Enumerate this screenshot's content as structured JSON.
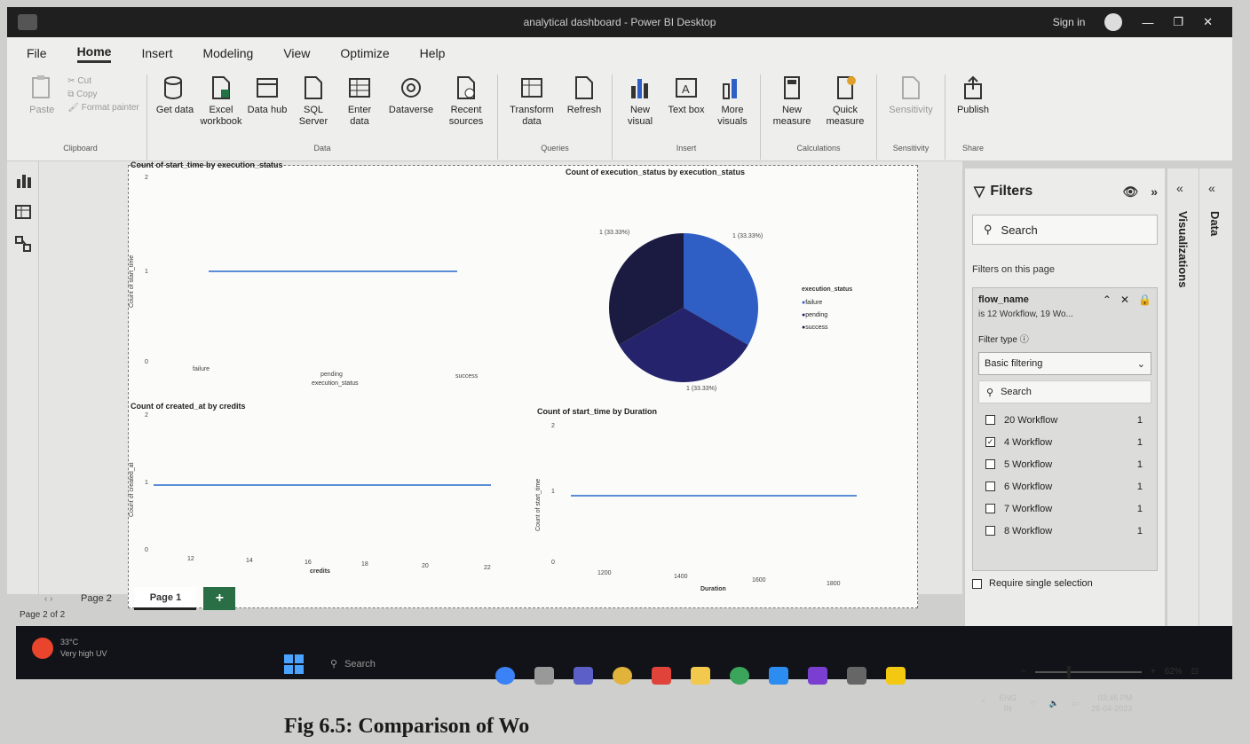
{
  "window": {
    "title": "analytical dashboard - Power BI Desktop",
    "sign_in": "Sign in"
  },
  "menu": [
    "File",
    "Home",
    "Insert",
    "Modeling",
    "View",
    "Optimize",
    "Help"
  ],
  "ribbon": {
    "clipboard": {
      "paste": "Paste",
      "cut": "Cut",
      "copy": "Copy",
      "format_painter": "Format painter",
      "group": "Clipboard"
    },
    "data": {
      "get_data": "Get data",
      "excel": "Excel workbook",
      "data_hub": "Data hub",
      "sql": "SQL Server",
      "enter": "Enter data",
      "dataverse": "Dataverse",
      "recent": "Recent sources",
      "group": "Data"
    },
    "queries": {
      "transform": "Transform data",
      "refresh": "Refresh",
      "group": "Queries"
    },
    "insert": {
      "new_visual": "New visual",
      "text_box": "Text box",
      "more_visuals": "More visuals",
      "group": "Insert"
    },
    "calculations": {
      "new_measure": "New measure",
      "quick_measure": "Quick measure",
      "group": "Calculations"
    },
    "sensitivity": {
      "label": "Sensitivity",
      "group": "Sensitivity"
    },
    "share": {
      "publish": "Publish",
      "group": "Share"
    }
  },
  "charts": {
    "line1": {
      "title": "Count of start_time by execution_status",
      "ylabel": "Count of start_time",
      "xlabel": "execution_status",
      "y_ticks": [
        "2",
        "1",
        "0"
      ]
    },
    "pie": {
      "title": "Count of execution_status by execution_status",
      "legend_title": "execution_status",
      "label_top_left": "1 (33.33%)",
      "label_top_right": "1 (33.33%)",
      "label_bottom": "1 (33.33%)"
    },
    "line2": {
      "title": "Count of created_at by credits",
      "ylabel": "Count of created_at",
      "xlabel": "credits",
      "y_ticks": [
        "2",
        "1",
        "0"
      ],
      "x_ticks": [
        "12",
        "14",
        "16",
        "18",
        "20",
        "22"
      ]
    },
    "line3": {
      "title": "Count of start_time by Duration",
      "ylabel": "Count of start_time",
      "xlabel": "Duration",
      "y_ticks": [
        "2",
        "1",
        "0"
      ],
      "x_ticks": [
        "1200",
        "1400",
        "1600",
        "1800"
      ]
    }
  },
  "chart_data": [
    {
      "type": "line",
      "title": "Count of start_time by execution_status",
      "categories": [
        "failure",
        "pending",
        "success"
      ],
      "values": [
        1,
        1,
        1
      ],
      "xlabel": "execution_status",
      "ylabel": "Count of start_time",
      "ylim": [
        0,
        2
      ]
    },
    {
      "type": "pie",
      "title": "Count of execution_status by execution_status",
      "categories": [
        "failure",
        "pending",
        "success"
      ],
      "values": [
        1,
        1,
        1
      ],
      "colors": [
        "#2f5fc4",
        "#24236b",
        "#1b1b42"
      ],
      "legend": "right"
    },
    {
      "type": "line",
      "title": "Count of created_at by credits",
      "x": [
        11,
        23
      ],
      "y": [
        1,
        1
      ],
      "xlabel": "credits",
      "ylabel": "Count of created_at",
      "ylim": [
        0,
        2
      ]
    },
    {
      "type": "line",
      "title": "Count of start_time by Duration",
      "x": [
        1100,
        1900
      ],
      "y": [
        1,
        1
      ],
      "xlabel": "Duration",
      "ylabel": "Count of start_time",
      "ylim": [
        0,
        2
      ]
    }
  ],
  "pages": {
    "tabs": [
      "Page 2",
      "Page 1"
    ],
    "active": "Page 1",
    "add": "+",
    "status": "Page 2 of 2"
  },
  "filters": {
    "title": "Filters",
    "search": "Search",
    "section": "Filters on this page",
    "card_field": "flow_name",
    "card_value": "is 12 Workflow, 19 Wo...",
    "filter_type_label": "Filter type",
    "filter_type": "Basic filtering",
    "list_search": "Search",
    "items": [
      {
        "label": "20 Workflow",
        "count": "1",
        "checked": false
      },
      {
        "label": "4 Workflow",
        "count": "1",
        "checked": true
      },
      {
        "label": "5 Workflow",
        "count": "1",
        "checked": false
      },
      {
        "label": "6 Workflow",
        "count": "1",
        "checked": false
      },
      {
        "label": "7 Workflow",
        "count": "1",
        "checked": false
      },
      {
        "label": "8 Workflow",
        "count": "1",
        "checked": false
      }
    ],
    "require_single": "Require single selection"
  },
  "panes": {
    "visualizations": "Visualizations",
    "data": "Data"
  },
  "zoom": {
    "value": "62%"
  },
  "taskbar": {
    "temp": "33°C",
    "weather": "Very high UV",
    "search": "Search",
    "lang": "ENG",
    "region": "IN",
    "time": "03:46 PM",
    "date": "26-04-2023"
  },
  "caption": "Fig 6.5: Comparison of Wo"
}
